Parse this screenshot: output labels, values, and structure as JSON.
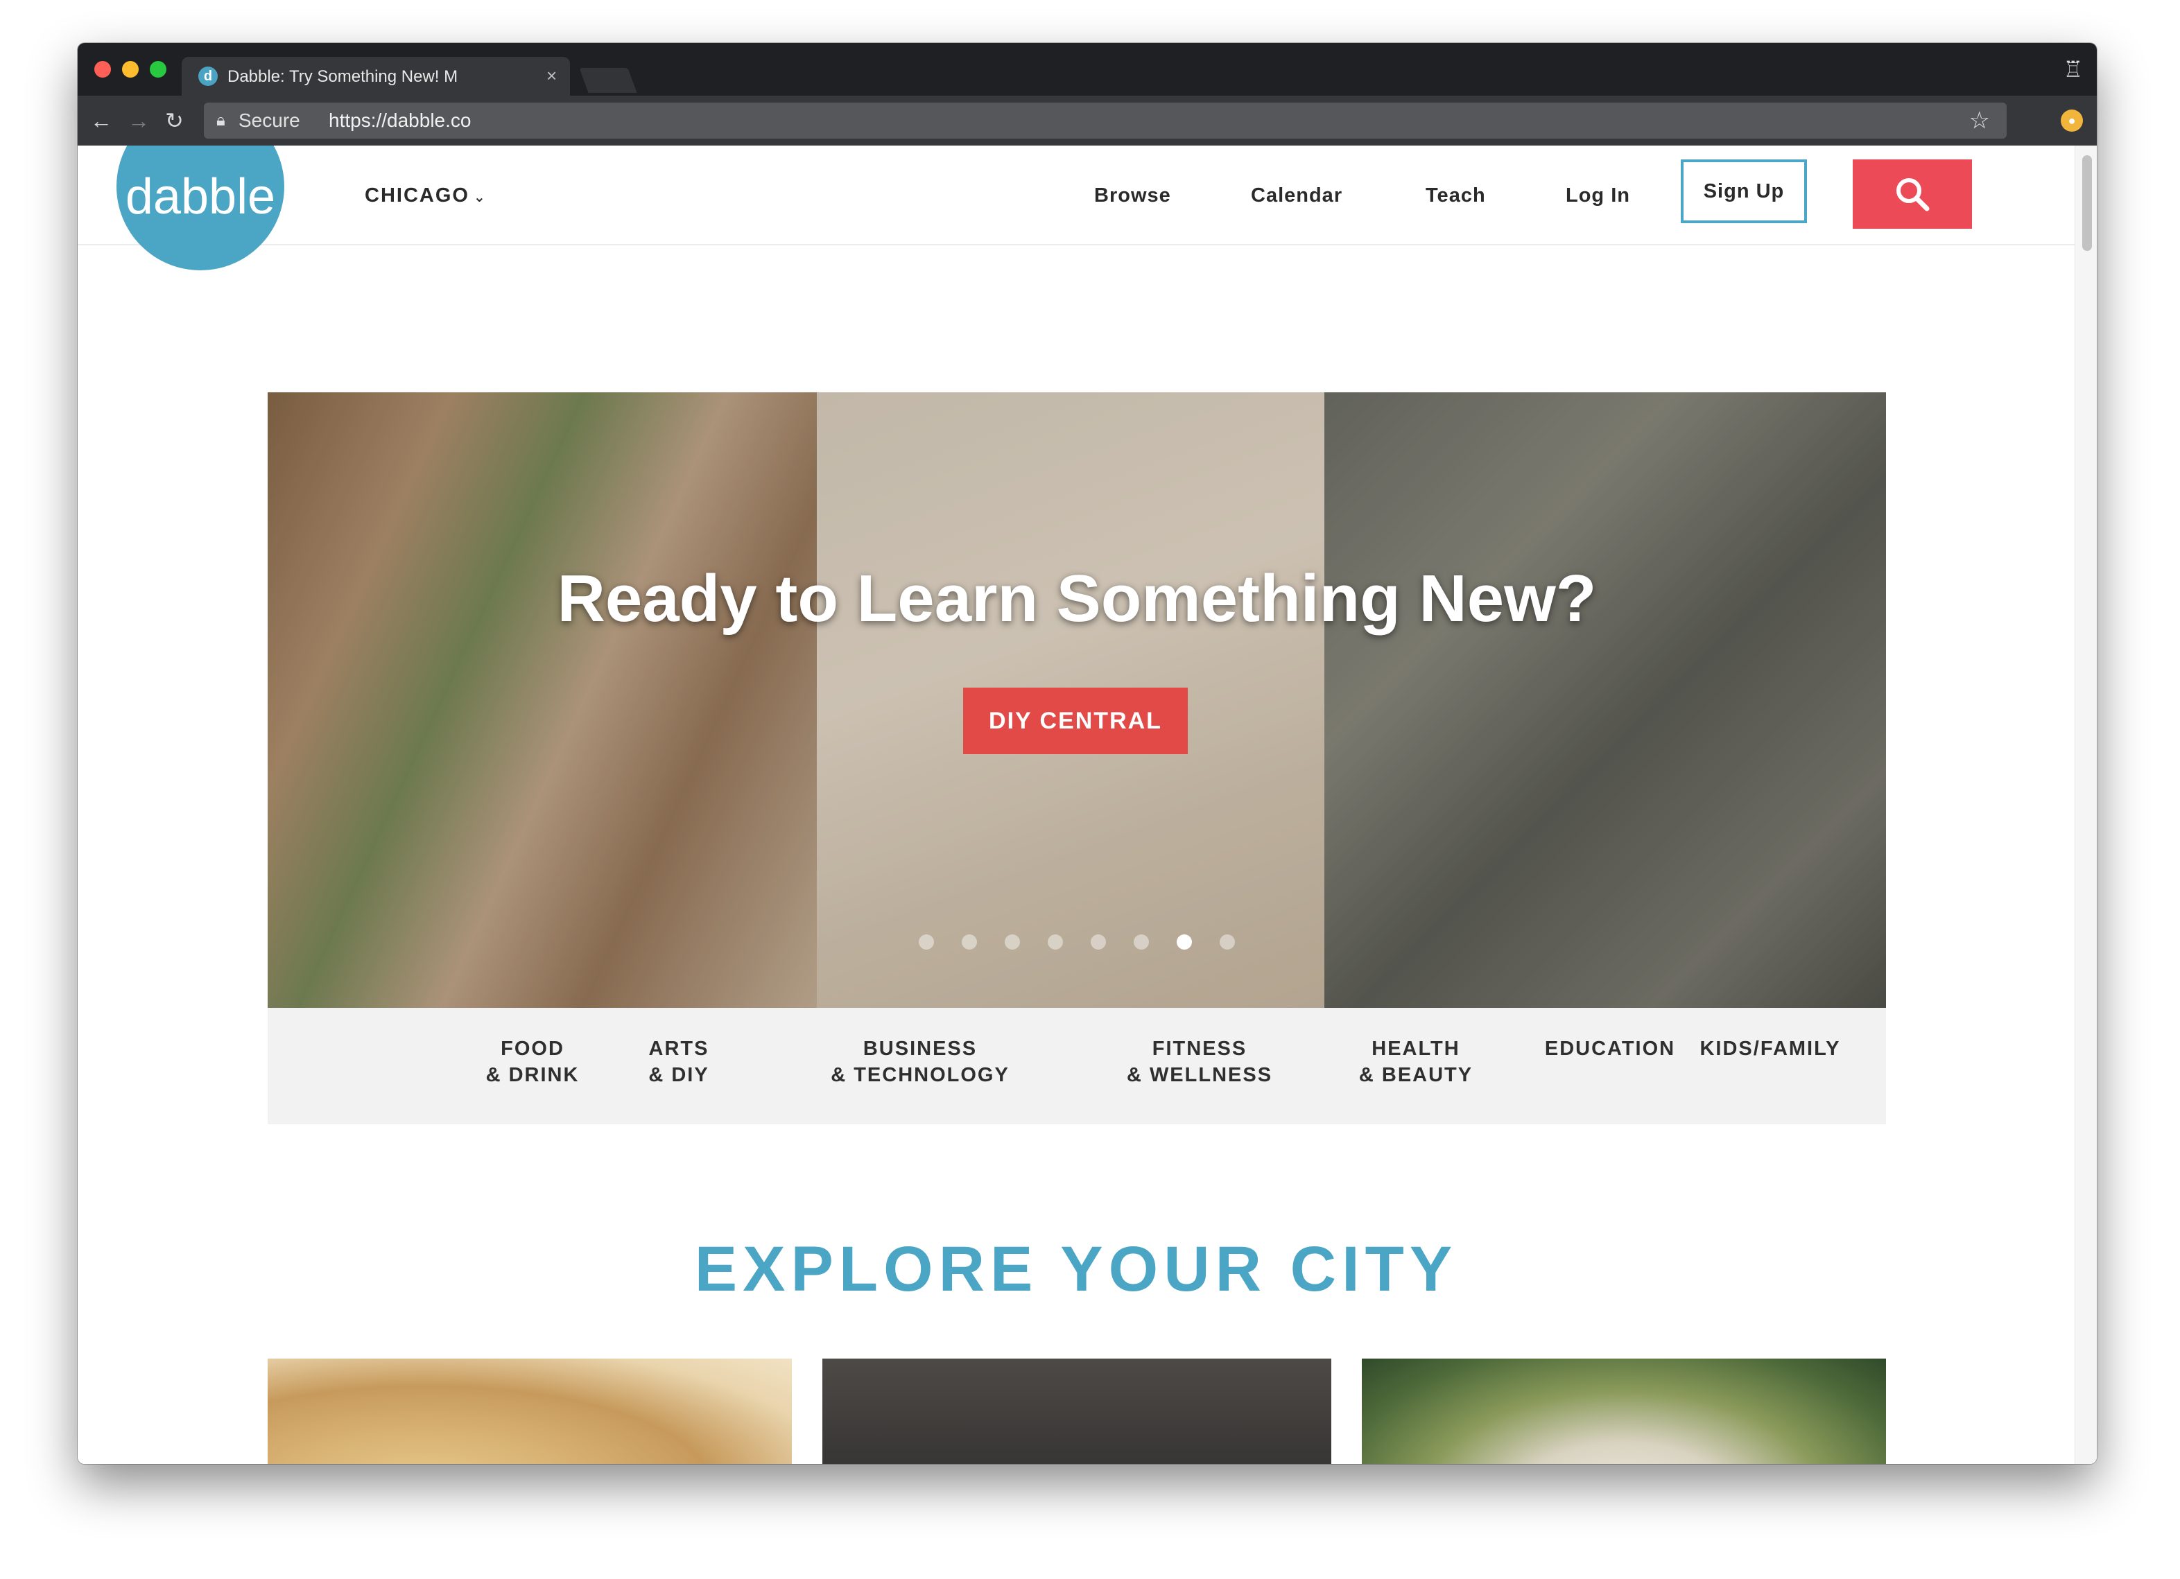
{
  "browser": {
    "tab_title": "Dabble: Try Something New! M",
    "tab_close": "×",
    "incognito_icon": "♖",
    "secure_label": "Secure",
    "url": "https://dabble.co"
  },
  "header": {
    "logo_text": "dabble",
    "city": "CHICAGO",
    "city_caret": "⌄",
    "nav": [
      "Browse",
      "Calendar",
      "Teach",
      "Log In"
    ],
    "signup": "Sign Up",
    "search_icon": "search-icon"
  },
  "hero": {
    "title": "Ready to Learn Something New?",
    "button": "DIY CENTRAL",
    "slides_total": 8,
    "active_slide": 7
  },
  "categories": [
    "FOOD\n& DRINK",
    "ARTS\n& DIY",
    "BUSINESS\n& TECHNOLOGY",
    "FITNESS\n& WELLNESS",
    "HEALTH\n& BEAUTY",
    "EDUCATION",
    "KIDS/FAMILY"
  ],
  "explore": {
    "heading": "EXPLORE YOUR CITY"
  },
  "colors": {
    "brand_teal": "#4aa6c4",
    "accent_red": "#ec4a57",
    "cta_red": "#e24a48"
  }
}
